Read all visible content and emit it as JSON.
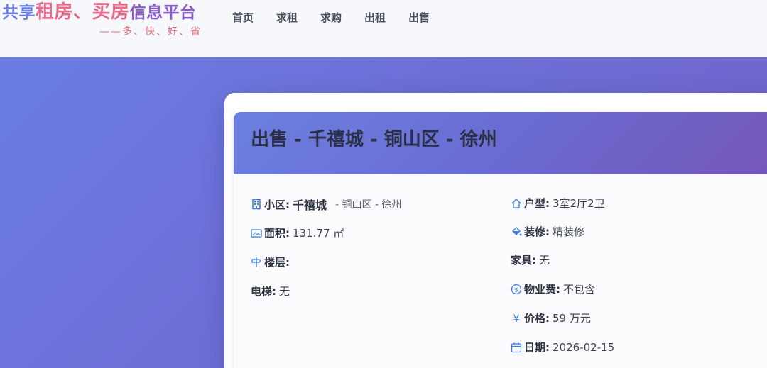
{
  "header": {
    "logo_part1": "共享",
    "logo_part2": "租房、买房",
    "logo_part3": "信息平台",
    "slogan": "——多、快、好、省",
    "nav": [
      "首页",
      "求租",
      "求购",
      "出租",
      "出售"
    ]
  },
  "listing": {
    "title": "出售 - 千禧城 - 铜山区 - 徐州",
    "community_label": "小区:",
    "community_value": "千禧城",
    "community_location": "- 铜山区 - 徐州",
    "area_label": "面积:",
    "area_value": "131.77 ㎡",
    "floor_label": "楼层:",
    "floor_value": "",
    "elevator_label": "电梯:",
    "elevator_value": "无",
    "layout_label": "户型:",
    "layout_value": "3室2厅2卫",
    "decoration_label": "装修:",
    "decoration_value": "精装修",
    "furniture_label": "家具:",
    "furniture_value": "无",
    "property_fee_label": "物业费:",
    "property_fee_value": "不包含",
    "price_label": "价格:",
    "price_value": "59 万元",
    "date_label": "日期:",
    "date_value": "2026-02-15"
  },
  "icons": {
    "community": "building-icon",
    "area": "area-icon",
    "floor": "signpost-icon",
    "layout": "house-icon",
    "decoration": "paint-bucket-icon",
    "property_fee": "dollar-coin-icon",
    "price": "yuan-icon",
    "date": "calendar-icon"
  },
  "colors": {
    "accent_blue": "#3b7be0",
    "logo_pink": "#e76a8a",
    "logo_blue": "#6a7fe6",
    "logo_purple": "#8a5cc8"
  }
}
